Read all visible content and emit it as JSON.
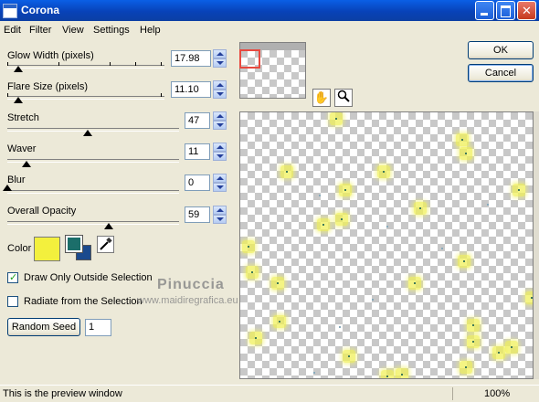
{
  "window": {
    "title": "Corona"
  },
  "menu": [
    "Edit",
    "Filter",
    "View",
    "Settings",
    "Help"
  ],
  "controls": {
    "glow_width": {
      "label": "Glow Width (pixels)",
      "value": "17.98",
      "slider_pct": 0.07
    },
    "flare_size": {
      "label": "Flare Size (pixels)",
      "value": "11.10",
      "slider_pct": 0.07
    },
    "stretch": {
      "label": "Stretch",
      "value": "47",
      "slider_pct": 0.47
    },
    "waver": {
      "label": "Waver",
      "value": "11",
      "slider_pct": 0.11
    },
    "blur": {
      "label": "Blur",
      "value": "0",
      "slider_pct": 0.0
    },
    "overall_opacity": {
      "label": "Overall Opacity",
      "value": "59",
      "slider_pct": 0.59
    }
  },
  "color": {
    "label": "Color",
    "primary": "#f3f03d",
    "secondary_top": "#1b6e6a",
    "secondary_bottom": "#1a4a8e"
  },
  "options": {
    "draw_only_outside": {
      "label": "Draw Only Outside Selection",
      "checked": true
    },
    "radiate_from_selection": {
      "label": "Radiate from the Selection",
      "checked": false
    }
  },
  "random_seed": {
    "button_label": "Random Seed",
    "value": "1"
  },
  "buttons": {
    "ok": "OK",
    "cancel": "Cancel"
  },
  "watermark": {
    "line1": "Pinuccia",
    "line2": "www.maidiregrafica.eu"
  },
  "status": {
    "text": "This is the preview window",
    "zoom": "100%"
  },
  "icons": [
    "hand-icon",
    "magnifier-icon",
    "eyedropper-icon"
  ]
}
